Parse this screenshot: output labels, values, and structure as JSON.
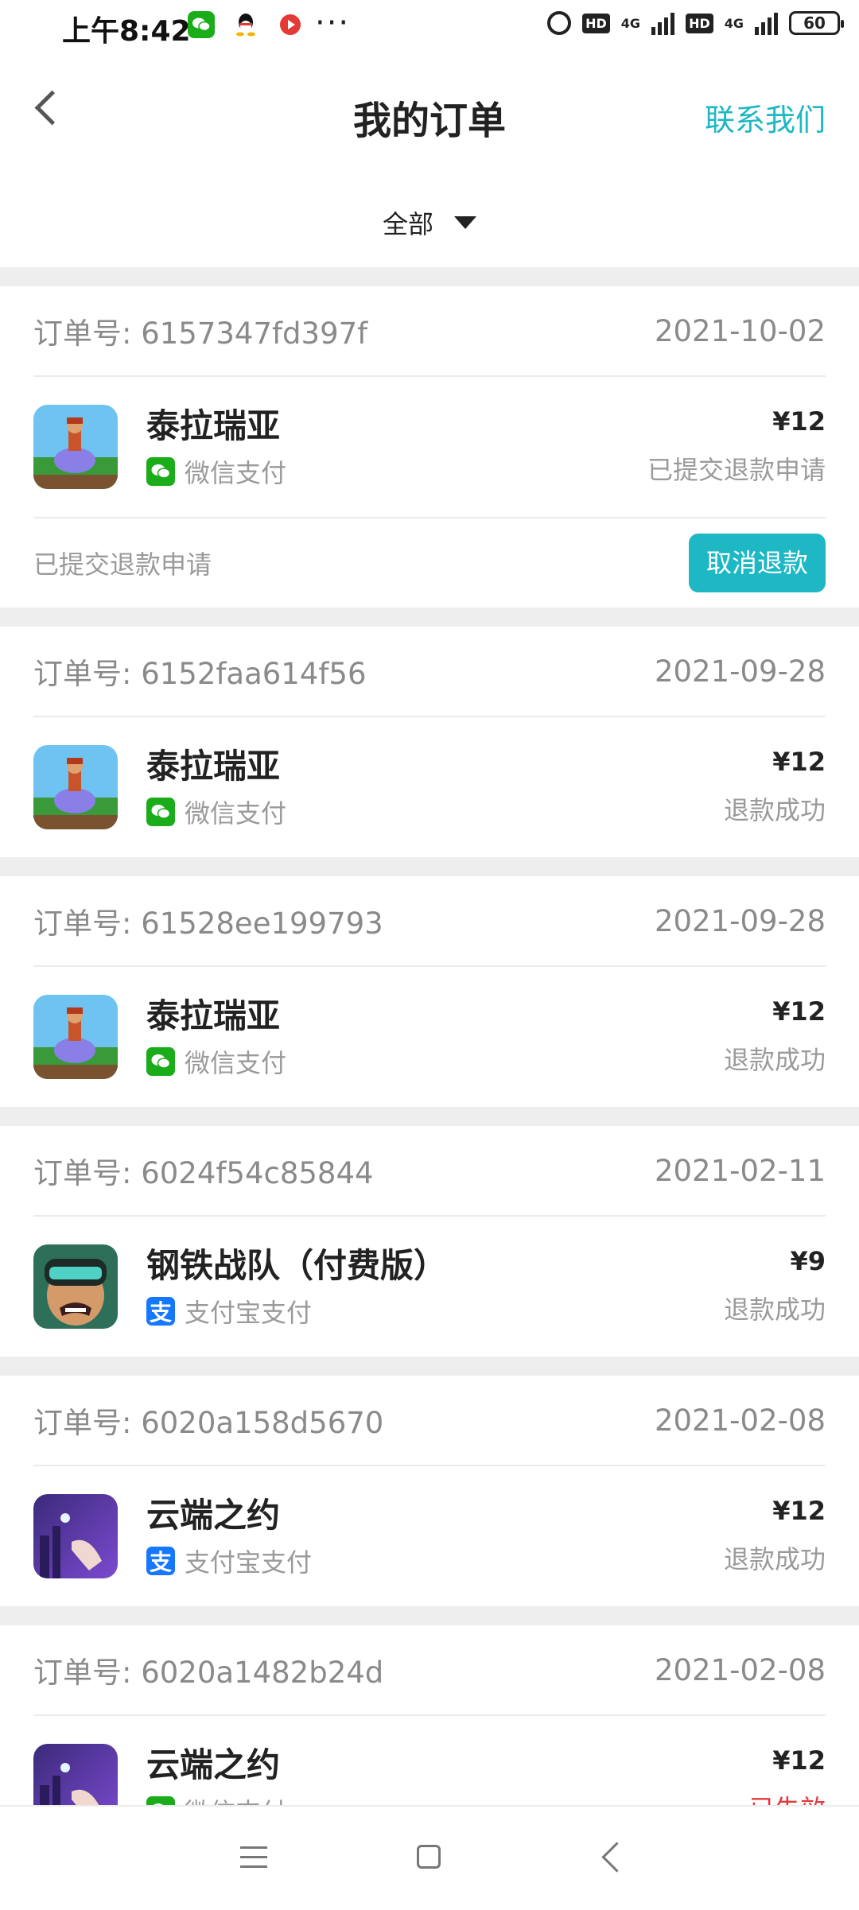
{
  "status_bar": {
    "time": "上午8:42",
    "hd_label": "HD",
    "net_label": "4G",
    "battery": "60"
  },
  "header": {
    "title": "我的订单",
    "contact_label": "联系我们"
  },
  "filter": {
    "selected": "全部"
  },
  "orders": [
    {
      "order_no": "订单号: 6157347fd397f",
      "date": "2021-10-02",
      "app_name": "泰拉瑞亚",
      "pay_method": "微信支付",
      "price": "¥12",
      "status": "已提交退款申请",
      "footer_status": "已提交退款申请",
      "action_label": "取消退款"
    },
    {
      "order_no": "订单号: 6152faa614f56",
      "date": "2021-09-28",
      "app_name": "泰拉瑞亚",
      "pay_method": "微信支付",
      "price": "¥12",
      "status": "退款成功"
    },
    {
      "order_no": "订单号: 61528ee199793",
      "date": "2021-09-28",
      "app_name": "泰拉瑞亚",
      "pay_method": "微信支付",
      "price": "¥12",
      "status": "退款成功"
    },
    {
      "order_no": "订单号: 6024f54c85844",
      "date": "2021-02-11",
      "app_name": "钢铁战队（付费版）",
      "pay_method": "支付宝支付",
      "price": "¥9",
      "status": "退款成功"
    },
    {
      "order_no": "订单号: 6020a158d5670",
      "date": "2021-02-08",
      "app_name": "云端之约",
      "pay_method": "支付宝支付",
      "price": "¥12",
      "status": "退款成功"
    },
    {
      "order_no": "订单号: 6020a1482b24d",
      "date": "2021-02-08",
      "app_name": "云端之约",
      "pay_method": "微信支付",
      "price": "¥12",
      "status": "已失效"
    }
  ],
  "colors": {
    "accent": "#1eb7c4",
    "wechat": "#1aad19",
    "alipay": "#1677ff",
    "failed": "#e5383b"
  },
  "icons": {
    "alipay_glyph": "支"
  }
}
